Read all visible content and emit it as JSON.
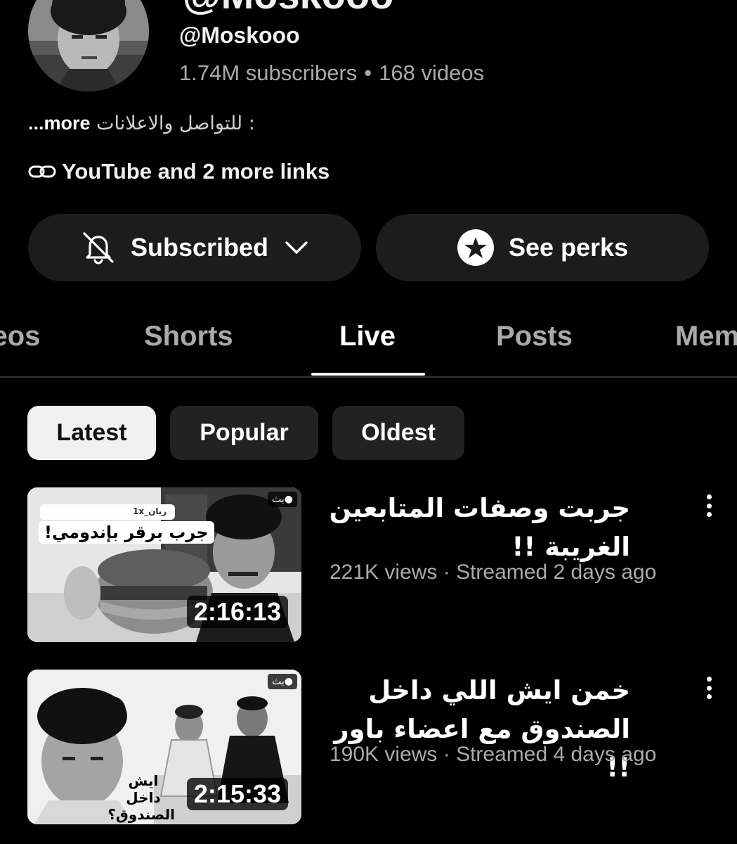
{
  "channel": {
    "name": "@Moskooo",
    "handle": "@Moskooo",
    "subscribers": "1.74M subscribers",
    "separator": "•",
    "videos": "168 videos",
    "description": "للتواصل والاعلانات :",
    "more_label": "...more",
    "links_label": "YouTube and 2 more links"
  },
  "actions": {
    "subscribed_label": "Subscribed",
    "perks_label": "See perks"
  },
  "tabs": [
    {
      "label": "Videos"
    },
    {
      "label": "Shorts"
    },
    {
      "label": "Live"
    },
    {
      "label": "Posts"
    },
    {
      "label": "Membership"
    }
  ],
  "active_tab": "Live",
  "filters": [
    {
      "label": "Latest",
      "selected": true
    },
    {
      "label": "Popular",
      "selected": false
    },
    {
      "label": "Oldest",
      "selected": false
    }
  ],
  "videos": [
    {
      "title": "جربت وصفات المتابعين الغريبة !!",
      "meta": "221K views · Streamed 2 days ago",
      "duration": "2:16:13",
      "live_badge": "بث●",
      "thumb_text": "جرب برقر بإندومي!",
      "thumb_user": "ريان_1x"
    },
    {
      "title": "خمن ايش اللي داخل الصندوق مع اعضاء باور !!",
      "meta": "190K views · Streamed 4 days ago",
      "duration": "2:15:33",
      "live_badge": "بث●",
      "thumb_text": "ايش داخل الصندوق؟"
    }
  ]
}
